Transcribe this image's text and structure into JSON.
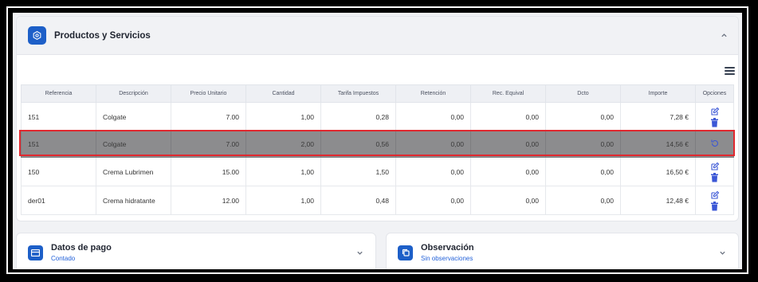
{
  "products": {
    "title": "Productos y Servicios",
    "columns": [
      "Referencia",
      "Descripción",
      "Precio Unitario",
      "Cantidad",
      "Tarifa Impuestos",
      "Retención",
      "Rec. Equival",
      "Dcto",
      "Importe",
      "Opciones"
    ],
    "rows": [
      {
        "ref": "151",
        "desc": "Colgate",
        "price": "7.00",
        "qty": "1,00",
        "tax": "0,28",
        "ret": "0,00",
        "rec": "0,00",
        "dcto": "0,00",
        "amount": "7,28 €"
      },
      {
        "ref": "151",
        "desc": "Colgate",
        "price": "7.00",
        "qty": "2,00",
        "tax": "0,56",
        "ret": "0,00",
        "rec": "0,00",
        "dcto": "0,00",
        "amount": "14,56 €"
      },
      {
        "ref": "150",
        "desc": "Crema Lubrimen",
        "price": "15.00",
        "qty": "1,00",
        "tax": "1,50",
        "ret": "0,00",
        "rec": "0,00",
        "dcto": "0,00",
        "amount": "16,50 €"
      },
      {
        "ref": "der01",
        "desc": "Crema hidratante",
        "price": "12.00",
        "qty": "1,00",
        "tax": "0,48",
        "ret": "0,00",
        "rec": "0,00",
        "dcto": "0,00",
        "amount": "12,48 €"
      }
    ]
  },
  "payment": {
    "title": "Datos de pago",
    "subtitle": "Contado"
  },
  "observation": {
    "title": "Observación",
    "subtitle": "Sin observaciones"
  },
  "colors": {
    "accent": "#1d5fc8",
    "link": "#2563d9",
    "highlight_border": "#e0282f",
    "edit_icon": "#3b57d6",
    "delete_icon": "#3b57d6"
  }
}
